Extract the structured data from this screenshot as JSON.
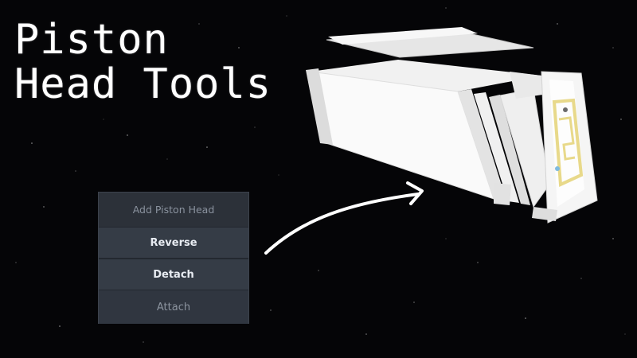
{
  "title_line1": "Piston",
  "title_line2": "Head Tools",
  "menu": {
    "header": "Add Piston Head",
    "items": [
      {
        "label": "Reverse"
      },
      {
        "label": "Detach"
      },
      {
        "label": "Attach"
      }
    ]
  },
  "colors": {
    "background": "#050507",
    "menu_bg": "#2a2f37",
    "piston_body": "#f4f4f4",
    "piston_accent": "#e8d98a"
  }
}
